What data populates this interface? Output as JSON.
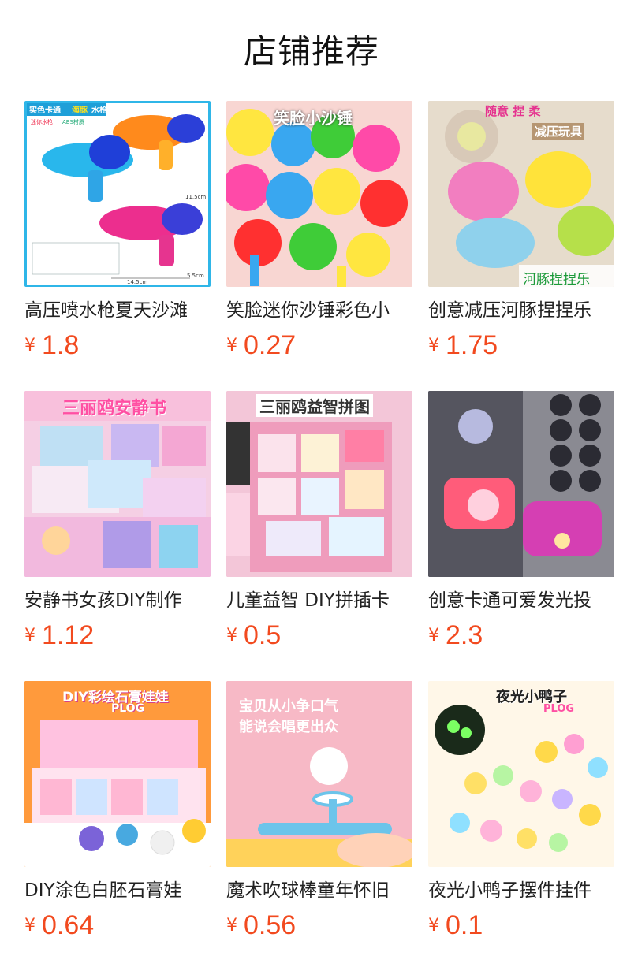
{
  "page": {
    "title": "店铺推荐"
  },
  "currency": "¥",
  "colors": {
    "price": "#f24a1f",
    "title": "#111111",
    "name": "#222222"
  },
  "products": [
    {
      "name": "高压喷水枪夏天沙滩",
      "price": "1.8",
      "image_text": [
        "实色卡通",
        "海豚",
        "水枪",
        "迷你水枪",
        "ABS材质",
        "14.5cm",
        "5.5cm",
        "11.5cm"
      ]
    },
    {
      "name": "笑脸迷你沙锤彩色小",
      "price": "0.27",
      "image_text": [
        "笑脸小沙锤"
      ]
    },
    {
      "name": "创意减压河豚捏捏乐",
      "price": "1.75",
      "image_text": [
        "随意 捏 柔",
        "减压玩具",
        "河豚捏捏乐"
      ]
    },
    {
      "name": "安静书女孩DIY制作",
      "price": "1.12",
      "image_text": [
        "三丽鸥安静书"
      ]
    },
    {
      "name": "儿童益智 DIY拼插卡",
      "price": "0.5",
      "image_text": [
        "三丽鸥益智拼图"
      ]
    },
    {
      "name": "创意卡通可爱发光投",
      "price": "2.3",
      "image_text": []
    },
    {
      "name": "DIY涂色白胚石膏娃",
      "price": "0.64",
      "image_text": [
        "DIY彩绘石膏娃娃",
        "PLOG"
      ]
    },
    {
      "name": "魔术吹球棒童年怀旧",
      "price": "0.56",
      "image_text": [
        "宝贝从小争口气",
        "能说会唱更出众"
      ]
    },
    {
      "name": "夜光小鸭子摆件挂件",
      "price": "0.1",
      "image_text": [
        "夜光小鸭子",
        "PLOG"
      ]
    }
  ]
}
